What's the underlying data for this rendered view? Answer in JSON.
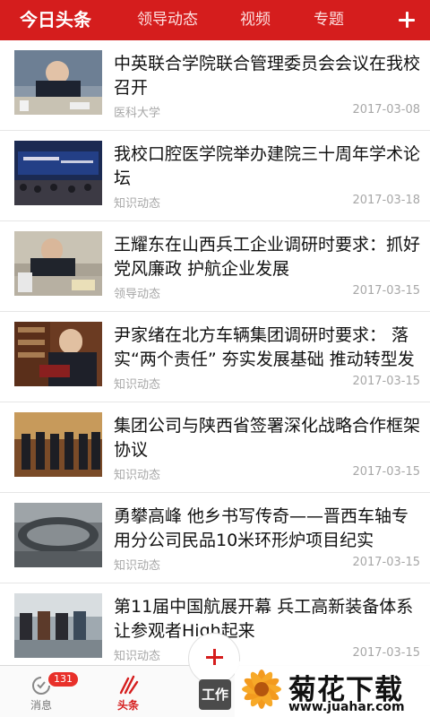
{
  "header": {
    "tabs": [
      "今日头条",
      "领导动态",
      "视频",
      "专题"
    ]
  },
  "articles": [
    {
      "title": "中英联合学院联合管理委员会会议在我校召开",
      "source": "医科大学",
      "date": "2017-03-08"
    },
    {
      "title": "我校口腔医学院举办建院三十周年学术论坛",
      "source": "知识动态",
      "date": "2017-03-18"
    },
    {
      "title": "王耀东在山西兵工企业调研时要求：抓好党风廉政 护航企业发展",
      "source": "领导动态",
      "date": "2017-03-15"
    },
    {
      "title": "尹家绪在北方车辆集团调研时要求： 落实“两个责任” 夯实发展基础 推动转型发",
      "source": "知识动态",
      "date": "2017-03-15"
    },
    {
      "title": "集团公司与陕西省签署深化战略合作框架协议",
      "source": "知识动态",
      "date": "2017-03-15"
    },
    {
      "title": "勇攀高峰 他乡书写传奇——晋西车轴专用分公司民品10米环形炉项目纪实",
      "source": "知识动态",
      "date": "2017-03-15"
    },
    {
      "title": "第11届中国航展开幕 兵工高新装备体系让参观者High起来",
      "source": "知识动态",
      "date": "2017-03-15"
    }
  ],
  "bottom_nav": {
    "messages_label": "消息",
    "messages_badge": "131",
    "news_label": "头条",
    "work_label": "工作"
  },
  "watermark": {
    "name": "菊花下载网",
    "url": "www.juahar.com"
  },
  "colors": {
    "brand_red": "#d51d1d",
    "meta_gray": "#a7a7a7"
  }
}
